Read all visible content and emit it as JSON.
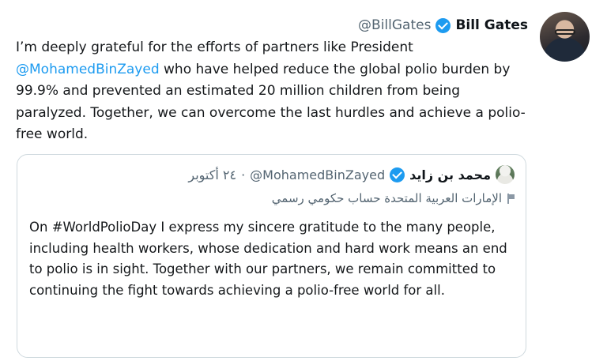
{
  "tweet": {
    "author_name": "Bill Gates",
    "author_handle": "@BillGates",
    "text_before_mention": "I’m deeply grateful for the efforts of partners like President ",
    "mention": "@MohamedBinZayed",
    "text_after_mention": " who have helped reduce the global polio burden by 99.9% and prevented an estimated 20 million children from being paralyzed. Together, we can overcome the last hurdles and achieve a polio-free world."
  },
  "quoted_tweet": {
    "author_name": "محمد بن زايد",
    "author_handle": "@MohamedBinZayed",
    "separator": "·",
    "timestamp": "٢٤ أكتوبر",
    "account_label": "الإمارات العربية المتحدة حساب حكومي رسمي",
    "text": "On #WorldPolioDay I express my sincere gratitude to the many people, including health workers, whose dedication and hard work means an end to polio is in sight. Together with our partners, we remain committed to continuing the fight towards achieving a polio-free world for all."
  },
  "colors": {
    "verified_badge": "#1d9bf0",
    "link": "#1d9bf0",
    "secondary_text": "#536471",
    "border": "#cfd9de"
  }
}
